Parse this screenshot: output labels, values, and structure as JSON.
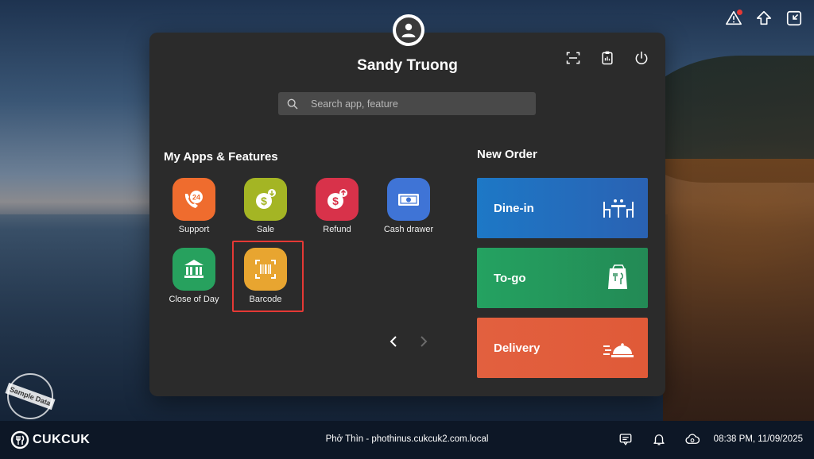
{
  "user": {
    "name": "Sandy Truong"
  },
  "search": {
    "placeholder": "Search app, feature"
  },
  "apps": {
    "title": "My Apps & Features",
    "items": [
      {
        "label": "Support",
        "icon": "support-24-icon",
        "color": "#ef6c2e"
      },
      {
        "label": "Sale",
        "icon": "sale-coin-icon",
        "color": "#a4b524"
      },
      {
        "label": "Refund",
        "icon": "refund-coin-icon",
        "color": "#d8324a"
      },
      {
        "label": "Cash drawer",
        "icon": "cash-drawer-icon",
        "color": "#3f74d6"
      },
      {
        "label": "Close of Day",
        "icon": "bank-icon",
        "color": "#27a15e"
      },
      {
        "label": "Barcode",
        "icon": "barcode-icon",
        "color": "#e8a530"
      }
    ]
  },
  "new_order": {
    "title": "New Order",
    "dine_in": "Dine-in",
    "to_go": "To-go",
    "delivery": "Delivery"
  },
  "stamp": {
    "label": "Sample Data"
  },
  "footer": {
    "brand": "CUKCUK",
    "store": "Phở Thìn - phothinus.cukcuk2.com.local",
    "datetime": "08:38 PM, 11/09/2025"
  },
  "colors": {
    "panel": "#2b2b2b",
    "highlight": "#e53935",
    "footer": "#0d1726"
  }
}
